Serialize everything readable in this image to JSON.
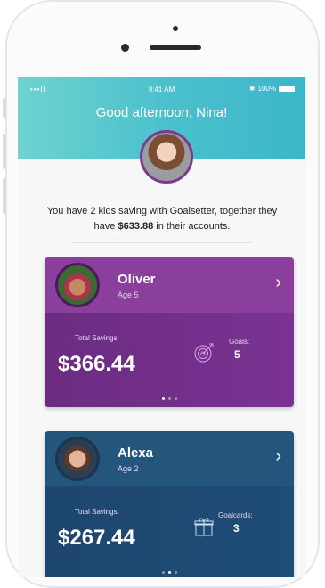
{
  "status": {
    "time": "9:41 AM",
    "battery": "100%",
    "signal": "•••ll",
    "wifi_icon": "wifi-icon",
    "bluetooth_icon": "bluetooth-icon"
  },
  "header": {
    "greeting": "Good afternoon, Nina!"
  },
  "summary": {
    "prefix": "You have 2 kids saving with Goalsetter, together they have",
    "amount": "$633.88",
    "suffix": "in their accounts."
  },
  "kids": [
    {
      "name": "Oliver",
      "age": "Age 5",
      "savings_label": "Total Savings:",
      "savings": "$366.44",
      "metric_label": "Goals:",
      "metric_value": "5",
      "metric_icon": "target-icon",
      "page_dots": 3,
      "active_dot": 0,
      "color": "#8a3f9c"
    },
    {
      "name": "Alexa",
      "age": "Age 2",
      "savings_label": "Total Savings:",
      "savings": "$267.44",
      "metric_label": "Goalcards:",
      "metric_value": "3",
      "metric_icon": "gift-icon",
      "page_dots": 3,
      "active_dot": 1,
      "color": "#24557d"
    }
  ],
  "colors": {
    "header_start": "#6fd3cf",
    "header_end": "#3db6cb",
    "oliver": "#8a3f9c",
    "alexa": "#24557d"
  }
}
